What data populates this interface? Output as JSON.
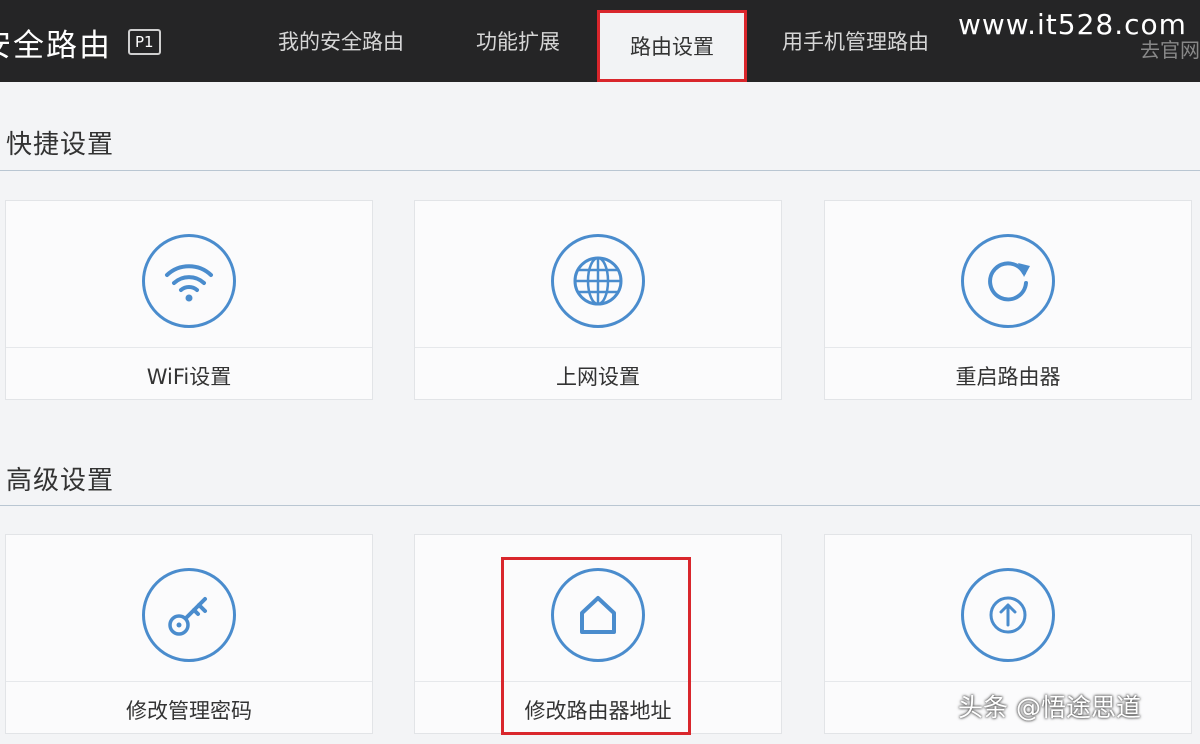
{
  "header": {
    "brand_title": "安全路由",
    "brand_badge": "P1",
    "nav": [
      {
        "label": "我的安全路由"
      },
      {
        "label": "功能扩展"
      },
      {
        "label": "路由设置"
      },
      {
        "label": "用手机管理路由"
      },
      {
        "label": "去官网"
      }
    ],
    "watermark": "www.it528.com"
  },
  "sections": [
    {
      "title": "快捷设置",
      "cards": [
        {
          "label": "WiFi设置",
          "icon": "wifi-icon"
        },
        {
          "label": "上网设置",
          "icon": "globe-icon"
        },
        {
          "label": "重启路由器",
          "icon": "restart-icon"
        }
      ]
    },
    {
      "title": "高级设置",
      "cards": [
        {
          "label": "修改管理密码",
          "icon": "key-icon"
        },
        {
          "label": "修改路由器地址",
          "icon": "home-icon"
        },
        {
          "label": "",
          "icon": "upgrade-arrow-icon"
        }
      ]
    }
  ],
  "footer_watermark": "头条 @悟途思道",
  "colors": {
    "topbar": "#252526",
    "accent_blue": "#4a8ccd",
    "highlight_red": "#d9262c"
  }
}
